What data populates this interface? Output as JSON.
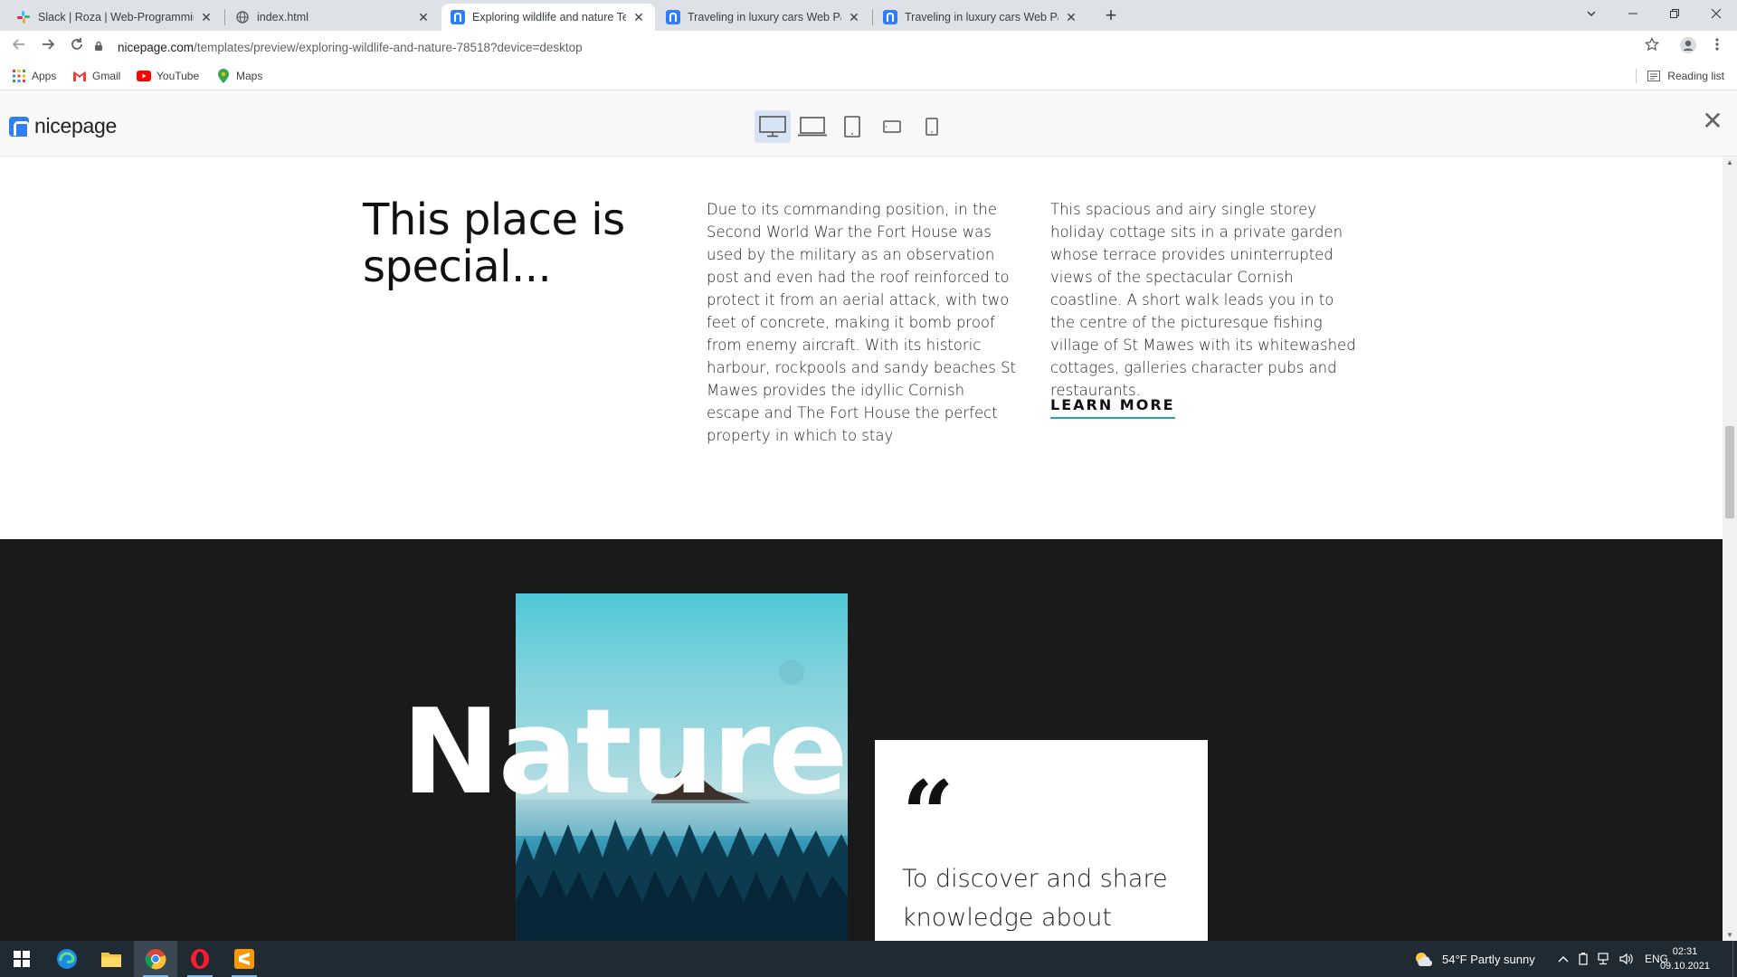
{
  "browser": {
    "tabs": [
      {
        "title": "Slack | Roza | Web-Programming",
        "icon": "slack-icon",
        "active": false
      },
      {
        "title": "index.html",
        "icon": "globe-icon",
        "active": false
      },
      {
        "title": "Exploring wildlife and nature Ter",
        "icon": "nicepage-icon",
        "active": true
      },
      {
        "title": "Traveling in luxury cars Web Page",
        "icon": "nicepage-icon",
        "active": false
      },
      {
        "title": "Traveling in luxury cars Web Page",
        "icon": "nicepage-icon",
        "active": false
      }
    ],
    "close_glyph": "✕",
    "new_tab_glyph": "+",
    "url_domain": "nicepage.com",
    "url_path": "/templates/preview/exploring-wildlife-and-nature-78518?device=desktop",
    "bookmarks": [
      {
        "label": "Apps",
        "icon": "apps-grid-icon"
      },
      {
        "label": "Gmail",
        "icon": "gmail-icon"
      },
      {
        "label": "YouTube",
        "icon": "youtube-icon"
      },
      {
        "label": "Maps",
        "icon": "maps-pin-icon"
      }
    ],
    "reading_list": "Reading list"
  },
  "preview_header": {
    "logo_text": "nicepage",
    "devices": [
      "desktop",
      "laptop",
      "tablet",
      "phone-landscape",
      "phone-portrait"
    ],
    "active_device": "desktop",
    "close_glyph": "✕"
  },
  "section1": {
    "heading": "This place is special...",
    "col1": "Due to its commanding position, in the Second World War the Fort House was used by the military as an observation post and even had the roof reinforced to protect it from an aerial attack, with two feet of concrete, making it bomb proof from enemy aircraft. With its historic harbour, rockpools and sandy beaches St Mawes provides the idyllic Cornish escape and The Fort House the perfect property in which to stay",
    "col2": "This spacious and airy single storey holiday cottage sits in a private garden whose terrace provides uninterrupted views of the spectacular Cornish coastline. A short walk leads you in to the centre of the picturesque fishing village of St Mawes with its whitewashed cottages, galleries character pubs and restaurants.",
    "learn_more": "LEARN MORE"
  },
  "section2": {
    "big_word": "Nature",
    "quote_mark": "“",
    "quote_text": "To discover and share knowledge about plants"
  },
  "taskbar": {
    "weather": "54°F  Partly sunny",
    "language": "ENG",
    "time": "02:31",
    "date": "09.10.2021"
  },
  "colors": {
    "accent_underline": "#1fa8a0",
    "nicepage_blue": "#2d7ef7",
    "dark_section": "#1a1a1a"
  }
}
